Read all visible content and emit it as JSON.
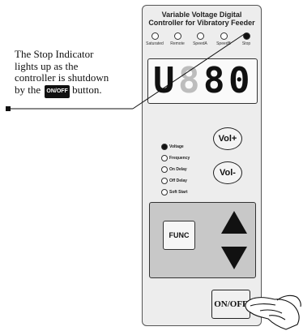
{
  "callout": {
    "line1": "The Stop Indicator",
    "line2": "lights up as the",
    "line3": "controller is shutdown",
    "line4_prefix": "by the",
    "line4_button": "ON/OFF",
    "line4_suffix": "button."
  },
  "panel": {
    "title_line1": "Variable Voltage Digital",
    "title_line2": "Controller for Vibratory Feeder",
    "indicators": [
      {
        "label": "Saturated",
        "on": false
      },
      {
        "label": "Remote",
        "on": false
      },
      {
        "label": "SpeedA",
        "on": false
      },
      {
        "label": "SpeedB",
        "on": false
      },
      {
        "label": "Stop",
        "on": true
      }
    ],
    "display": {
      "digits": [
        {
          "char": "U",
          "lit": true
        },
        {
          "char": "8",
          "lit": false
        },
        {
          "char": "8",
          "lit": true
        },
        {
          "char": "0",
          "lit": true
        }
      ]
    },
    "modes": [
      {
        "label": "Voltage",
        "on": true
      },
      {
        "label": "Frequency",
        "on": false
      },
      {
        "label": "On Delay",
        "on": false
      },
      {
        "label": "Off Delay",
        "on": false
      },
      {
        "label": "Soft Start",
        "on": false
      }
    ],
    "vol_up_label": "Vol+",
    "vol_down_label": "Vol-",
    "func_label": "FUNC",
    "onoff_label": "ON/OFF"
  },
  "colors": {
    "panel_bg": "#ededed",
    "keypad_bg": "#c8c8c8",
    "lit_segment": "#111111",
    "dim_segment": "#bdbdbd"
  }
}
